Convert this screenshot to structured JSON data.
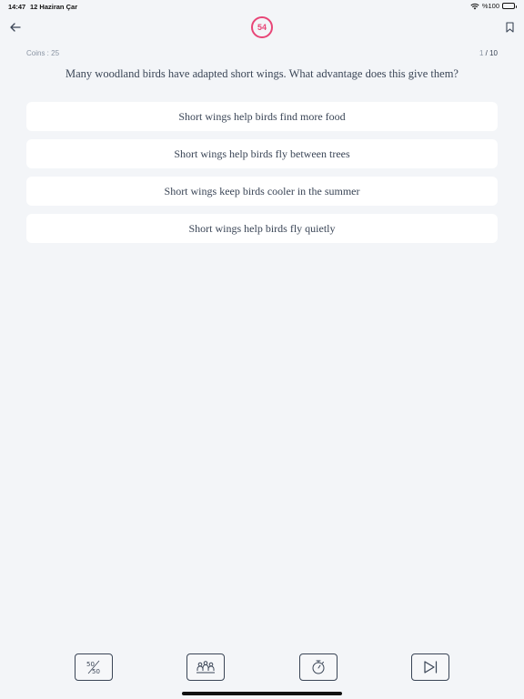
{
  "status_bar": {
    "time": "14:47",
    "date": "12 Haziran Çar",
    "battery": "%100"
  },
  "timer": {
    "value": "54",
    "accent_color": "#e84577"
  },
  "coins": {
    "label": "Coins : 25"
  },
  "progress": {
    "current": "1",
    "separator": " / 10"
  },
  "question": {
    "text": "Many woodland birds have adapted short wings. What advantage does this give them?"
  },
  "options": [
    {
      "label": "Short wings help birds find more food"
    },
    {
      "label": "Short wings help birds fly between trees"
    },
    {
      "label": "Short wings keep birds cooler in the summer"
    },
    {
      "label": "Short wings help birds fly quietly"
    }
  ],
  "toolbar": {
    "fifty_fifty_icon": "fifty-fifty-icon",
    "audience_icon": "audience-icon",
    "timer_icon": "stopwatch-icon",
    "skip_icon": "skip-next-icon"
  }
}
